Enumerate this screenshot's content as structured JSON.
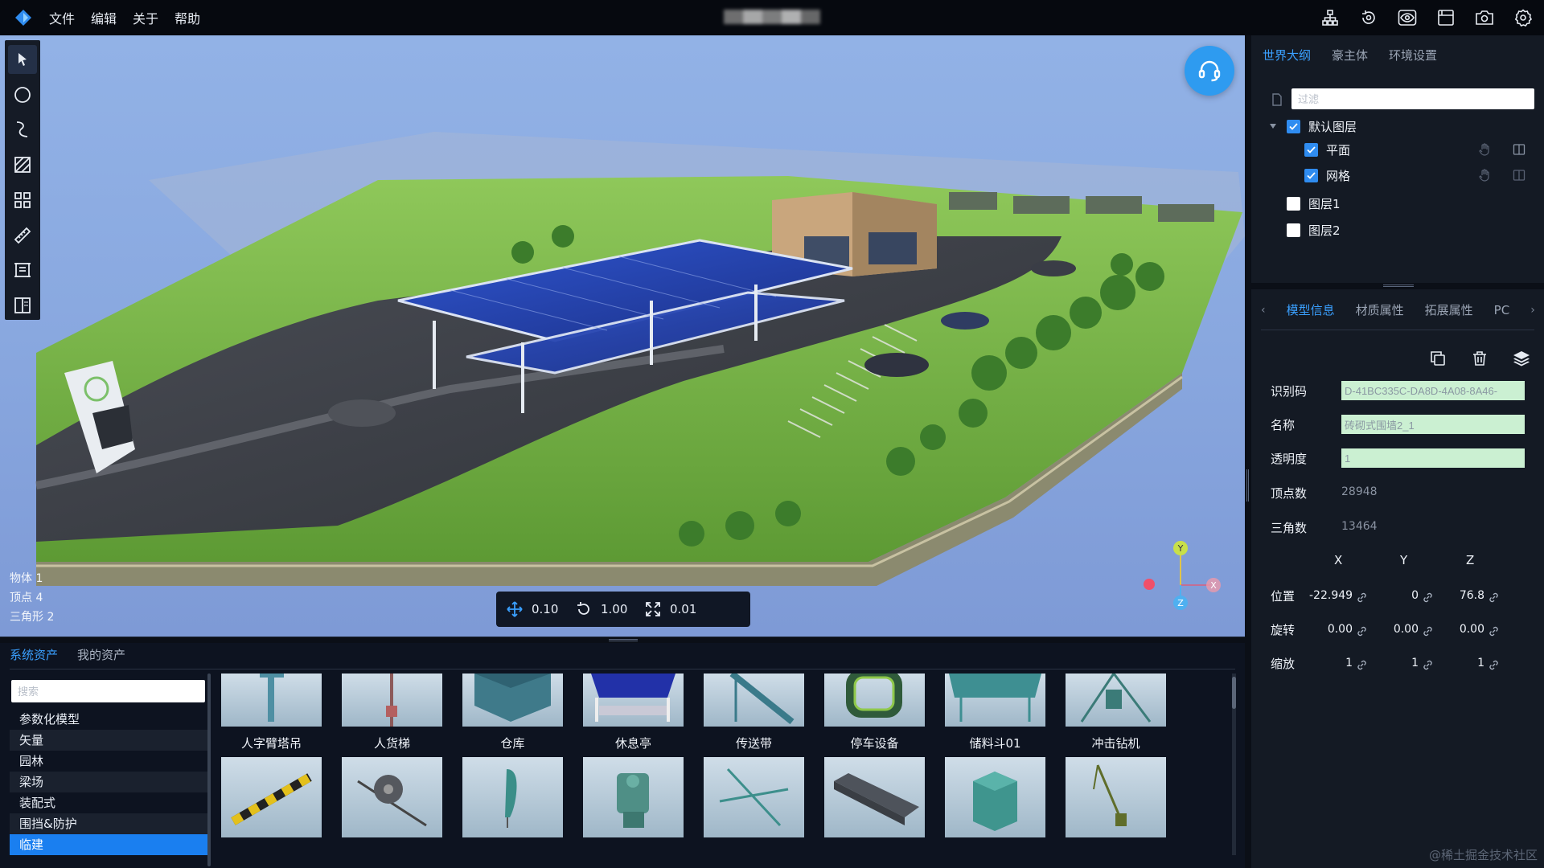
{
  "menu": [
    "文件",
    "编辑",
    "关于",
    "帮助"
  ],
  "top_icons": [
    "hierarchy-icon",
    "rotate-view-icon",
    "eye-view-icon",
    "save-icon",
    "camera-icon",
    "settings-icon"
  ],
  "viewport": {
    "stats": {
      "objects": "物体 1",
      "vertices": "顶点 4",
      "triangles": "三角形 2"
    },
    "transform": {
      "move": "0.10",
      "rotate": "1.00",
      "scale": "0.01"
    },
    "gizmo": {
      "y": "Y",
      "x": "X",
      "z": "Z"
    }
  },
  "assets": {
    "tabs": [
      "系统资产",
      "我的资产"
    ],
    "search_placeholder": "搜索",
    "categories": [
      "参数化模型",
      "矢量",
      "园林",
      "梁场",
      "装配式",
      "围挡&防护",
      "临建"
    ],
    "active_category": "临建",
    "items": [
      "人字臂塔吊",
      "人货梯",
      "仓库",
      "休息亭",
      "传送带",
      "停车设备",
      "储料斗01",
      "冲击钻机",
      "",
      "",
      "",
      "",
      "",
      "",
      "",
      ""
    ]
  },
  "outline": {
    "tabs": [
      "世界大纲",
      "豪主体",
      "环境设置"
    ],
    "filter_placeholder": "过滤",
    "layers": [
      {
        "label": "默认图层",
        "checked": true
      },
      {
        "label": "平面",
        "checked": true
      },
      {
        "label": "网格",
        "checked": true
      },
      {
        "label": "图层1",
        "checked": false
      },
      {
        "label": "图层2",
        "checked": false
      }
    ]
  },
  "props": {
    "tabs": [
      "模型信息",
      "材质属性",
      "拓展属性",
      "PC"
    ],
    "id_label": "识别码",
    "id_value": "D-41BC335C-DA8D-4A08-8A46-",
    "name_label": "名称",
    "name_value": "砖砌式围墙2_1",
    "opacity_label": "透明度",
    "opacity_value": "1",
    "vertex_label": "顶点数",
    "vertex_value": "28948",
    "tri_label": "三角数",
    "tri_value": "13464",
    "axis": [
      "X",
      "Y",
      "Z"
    ],
    "position_label": "位置",
    "position": [
      "-22.949",
      "0",
      "76.8"
    ],
    "rotation_label": "旋转",
    "rotation": [
      "0.00",
      "0.00",
      "0.00"
    ],
    "scale_label": "缩放",
    "scale": [
      "1",
      "1",
      "1"
    ]
  },
  "watermark": "@稀土掘金技术社区",
  "colors": {
    "accent": "#3aa0ff",
    "active_category": "#1a7ff0",
    "support_button": "#2e9bf0",
    "input_fill": "#cbf0d2"
  }
}
